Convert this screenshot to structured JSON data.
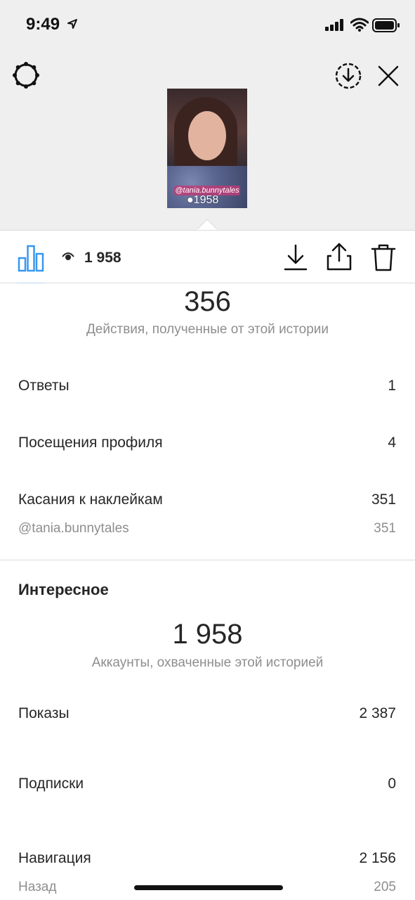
{
  "status_bar": {
    "time": "9:49"
  },
  "story": {
    "sticker_text": "@tania.bunnytales",
    "views_overlay": "1958"
  },
  "toolbar": {
    "views_count": "1 958"
  },
  "interactions": {
    "total": "356",
    "caption": "Действия, полученные от этой истории",
    "rows": [
      {
        "label": "Ответы",
        "value": "1"
      },
      {
        "label": "Посещения профиля",
        "value": "4"
      },
      {
        "label": "Касания к наклейкам",
        "value": "351"
      }
    ],
    "sticker_sub": {
      "label": "@tania.bunnytales",
      "value": "351"
    }
  },
  "discovery": {
    "title": "Интересное",
    "total": "1 958",
    "caption": "Аккаунты, охваченные этой историей",
    "rows": [
      {
        "label": "Показы",
        "value": "2 387"
      },
      {
        "label": "Подписки",
        "value": "0"
      },
      {
        "label": "Навигация",
        "value": "2 156"
      }
    ],
    "nav_sub": {
      "label": "Назад",
      "value": "205"
    }
  },
  "icons": {
    "settings": "settings-gear-icon",
    "save": "save-download-circle-icon",
    "close": "close-icon",
    "insights": "bar-chart-icon",
    "views": "eye-icon",
    "download": "download-icon",
    "share": "share-icon",
    "delete": "trash-icon"
  },
  "colors": {
    "accent": "#3897f0",
    "text": "#262626",
    "secondary_text": "#8e8e8e",
    "header_bg": "#efefef"
  }
}
